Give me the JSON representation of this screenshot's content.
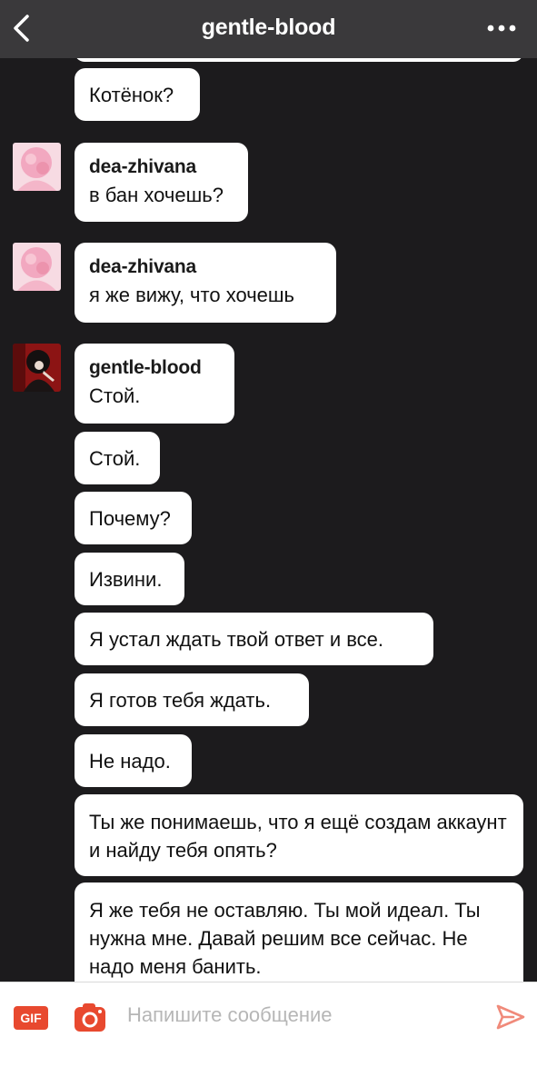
{
  "header": {
    "title": "gentle-blood",
    "back_icon": "chevron-left-icon",
    "more_icon": "more-horizontal-icon"
  },
  "messages": [
    {
      "text": "Котёнок?"
    },
    {
      "name": "dea-zhivana",
      "text": "в бан хочешь?"
    },
    {
      "name": "dea-zhivana",
      "text": "я же вижу, что хочешь"
    },
    {
      "name": "gentle-blood",
      "text": "Стой."
    },
    {
      "text": "Стой."
    },
    {
      "text": "Почему?"
    },
    {
      "text": "Извини."
    },
    {
      "text": "Я устал ждать твой ответ и все."
    },
    {
      "text": "Я готов тебя ждать."
    },
    {
      "text": "Не надо."
    },
    {
      "text": "Ты же понимаешь, что я ещё создам аккаунт и найду тебя опять?"
    },
    {
      "text": "Я же тебя не оставляю. Ты мой идеал. Ты нужна мне. Давай решим все сейчас. Не надо меня банить."
    }
  ],
  "composer": {
    "gif_label": "GIF",
    "placeholder": "Напишите сообщение",
    "value": "",
    "camera_icon": "camera-icon",
    "send_icon": "send-icon"
  },
  "colors": {
    "background": "#1c1b1d",
    "header": "#3a393b",
    "bubble": "#ffffff",
    "gif_accent": "#e8492f",
    "camera_accent": "#e8492f",
    "send_accent": "#f08a7a"
  }
}
